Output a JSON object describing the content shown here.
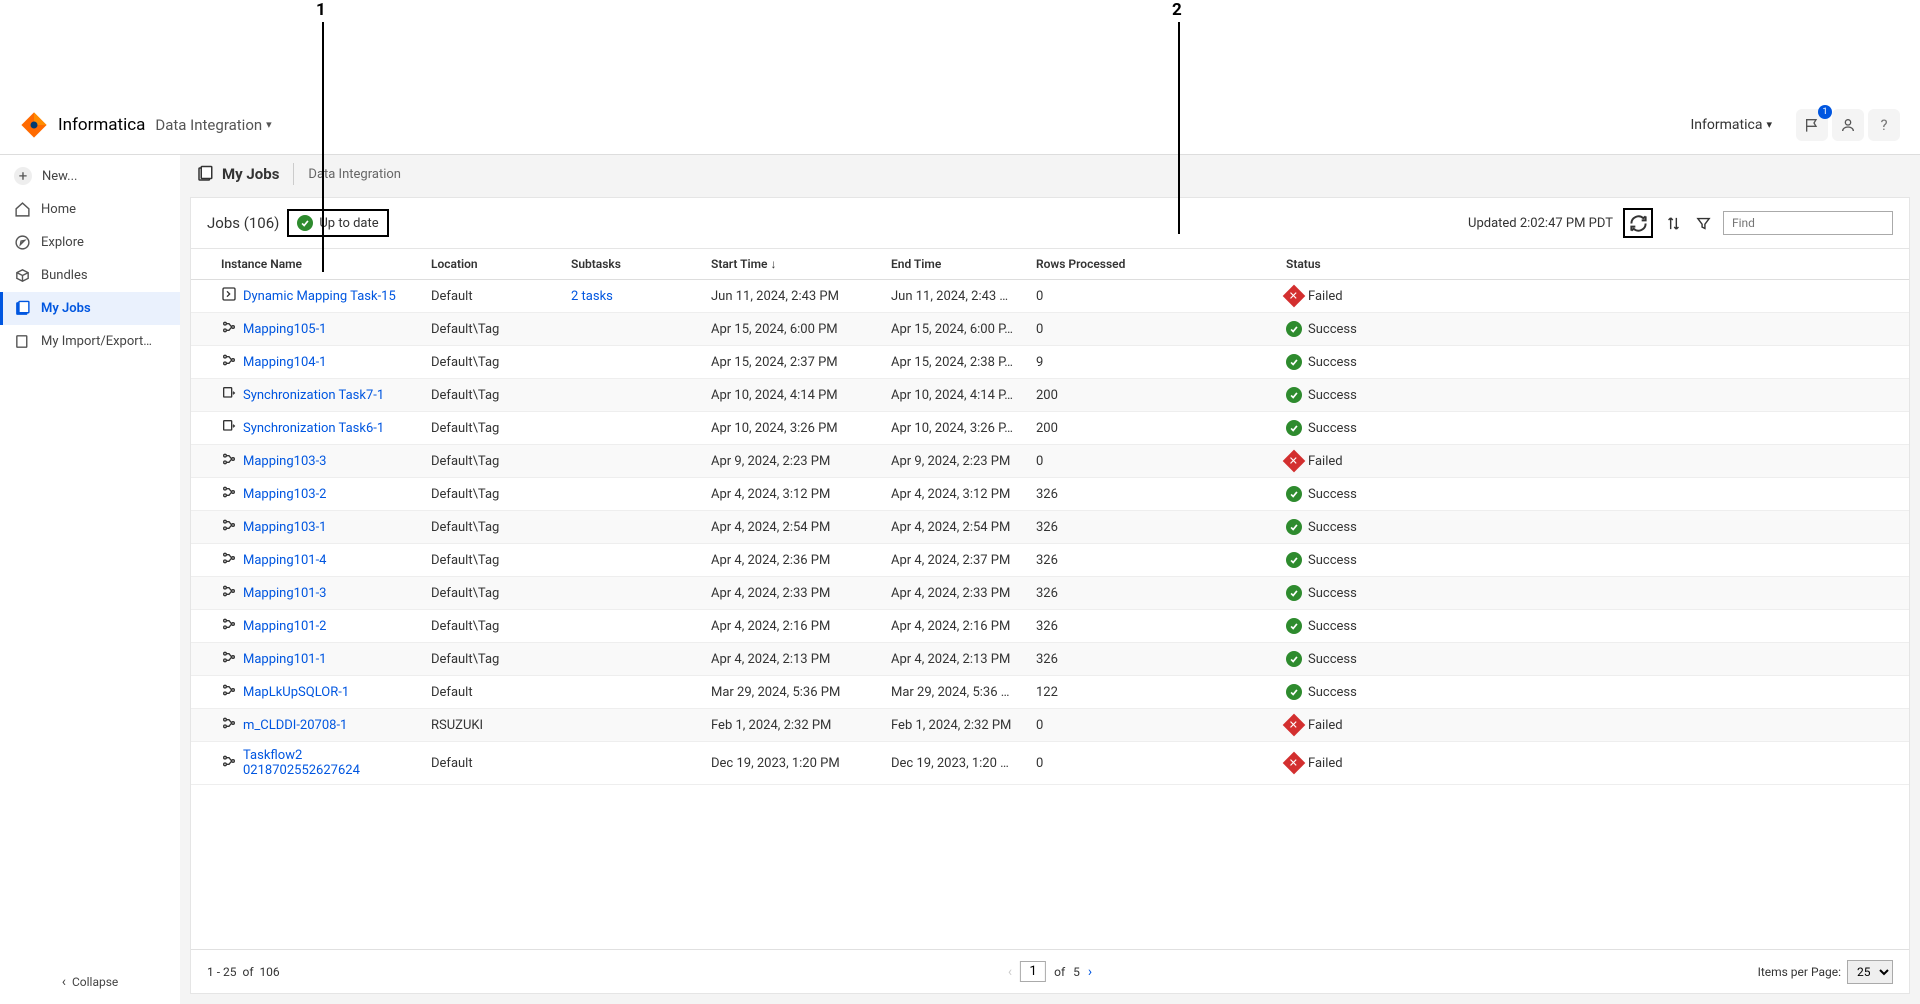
{
  "annotations": {
    "a1": "1",
    "a2": "2"
  },
  "header": {
    "brand": "Informatica",
    "app": "Data Integration",
    "org": "Informatica",
    "notif_count": "1"
  },
  "sidebar": {
    "new": "New...",
    "home": "Home",
    "explore": "Explore",
    "bundles": "Bundles",
    "myjobs": "My Jobs",
    "import": "My Import/Export…",
    "collapse": "Collapse"
  },
  "crumb": {
    "title": "My Jobs",
    "sub": "Data Integration"
  },
  "toolbar": {
    "jobs": "Jobs (106)",
    "uptodate": "Up to date",
    "updated": "Updated 2:02:47 PM PDT",
    "find_ph": "Find"
  },
  "columns": {
    "instance": "Instance Name",
    "location": "Location",
    "subtasks": "Subtasks",
    "start": "Start Time",
    "end": "End Time",
    "rows": "Rows Processed",
    "status": "Status"
  },
  "status_labels": {
    "success": "Success",
    "failed": "Failed"
  },
  "rows": [
    {
      "icon": "dyn",
      "name": "Dynamic Mapping Task-15",
      "loc": "Default",
      "sub": "2 tasks",
      "start": "Jun 11, 2024, 2:43 PM",
      "end": "Jun 11, 2024, 2:43 …",
      "rows": "0",
      "status": "failed"
    },
    {
      "icon": "map",
      "name": "Mapping105-1",
      "loc": "Default\\Tag",
      "sub": "",
      "start": "Apr 15, 2024, 6:00 PM",
      "end": "Apr 15, 2024, 6:00 P…",
      "rows": "0",
      "status": "success"
    },
    {
      "icon": "map",
      "name": "Mapping104-1",
      "loc": "Default\\Tag",
      "sub": "",
      "start": "Apr 15, 2024, 2:37 PM",
      "end": "Apr 15, 2024, 2:38 P…",
      "rows": "9",
      "status": "success"
    },
    {
      "icon": "sync",
      "name": "Synchronization Task7-1",
      "loc": "Default\\Tag",
      "sub": "",
      "start": "Apr 10, 2024, 4:14 PM",
      "end": "Apr 10, 2024, 4:14 P…",
      "rows": "200",
      "status": "success"
    },
    {
      "icon": "sync",
      "name": "Synchronization Task6-1",
      "loc": "Default\\Tag",
      "sub": "",
      "start": "Apr 10, 2024, 3:26 PM",
      "end": "Apr 10, 2024, 3:26 P…",
      "rows": "200",
      "status": "success"
    },
    {
      "icon": "map",
      "name": "Mapping103-3",
      "loc": "Default\\Tag",
      "sub": "",
      "start": "Apr 9, 2024, 2:23 PM",
      "end": "Apr 9, 2024, 2:23 PM",
      "rows": "0",
      "status": "failed"
    },
    {
      "icon": "map",
      "name": "Mapping103-2",
      "loc": "Default\\Tag",
      "sub": "",
      "start": "Apr 4, 2024, 3:12 PM",
      "end": "Apr 4, 2024, 3:12 PM",
      "rows": "326",
      "status": "success"
    },
    {
      "icon": "map",
      "name": "Mapping103-1",
      "loc": "Default\\Tag",
      "sub": "",
      "start": "Apr 4, 2024, 2:54 PM",
      "end": "Apr 4, 2024, 2:54 PM",
      "rows": "326",
      "status": "success"
    },
    {
      "icon": "map",
      "name": "Mapping101-4",
      "loc": "Default\\Tag",
      "sub": "",
      "start": "Apr 4, 2024, 2:36 PM",
      "end": "Apr 4, 2024, 2:37 PM",
      "rows": "326",
      "status": "success"
    },
    {
      "icon": "map",
      "name": "Mapping101-3",
      "loc": "Default\\Tag",
      "sub": "",
      "start": "Apr 4, 2024, 2:33 PM",
      "end": "Apr 4, 2024, 2:33 PM",
      "rows": "326",
      "status": "success"
    },
    {
      "icon": "map",
      "name": "Mapping101-2",
      "loc": "Default\\Tag",
      "sub": "",
      "start": "Apr 4, 2024, 2:16 PM",
      "end": "Apr 4, 2024, 2:16 PM",
      "rows": "326",
      "status": "success"
    },
    {
      "icon": "map",
      "name": "Mapping101-1",
      "loc": "Default\\Tag",
      "sub": "",
      "start": "Apr 4, 2024, 2:13 PM",
      "end": "Apr 4, 2024, 2:13 PM",
      "rows": "326",
      "status": "success"
    },
    {
      "icon": "map",
      "name": "MapLkUpSQLOR-1",
      "loc": "Default",
      "sub": "",
      "start": "Mar 29, 2024, 5:36 PM",
      "end": "Mar 29, 2024, 5:36 …",
      "rows": "122",
      "status": "success"
    },
    {
      "icon": "map",
      "name": "m_CLDDI-20708-1",
      "loc": "RSUZUKI",
      "sub": "",
      "start": "Feb 1, 2024, 2:32 PM",
      "end": "Feb 1, 2024, 2:32 PM",
      "rows": "0",
      "status": "failed"
    },
    {
      "icon": "map",
      "name": "Taskflow2 0218702552627624",
      "loc": "Default",
      "sub": "",
      "start": "Dec 19, 2023, 1:20 PM",
      "end": "Dec 19, 2023, 1:20 …",
      "rows": "0",
      "status": "failed"
    }
  ],
  "footer": {
    "range": "1 - 25",
    "of": "of",
    "total": "106",
    "page": "1",
    "pages": "5",
    "items_label": "Items per Page:",
    "items": "25"
  }
}
